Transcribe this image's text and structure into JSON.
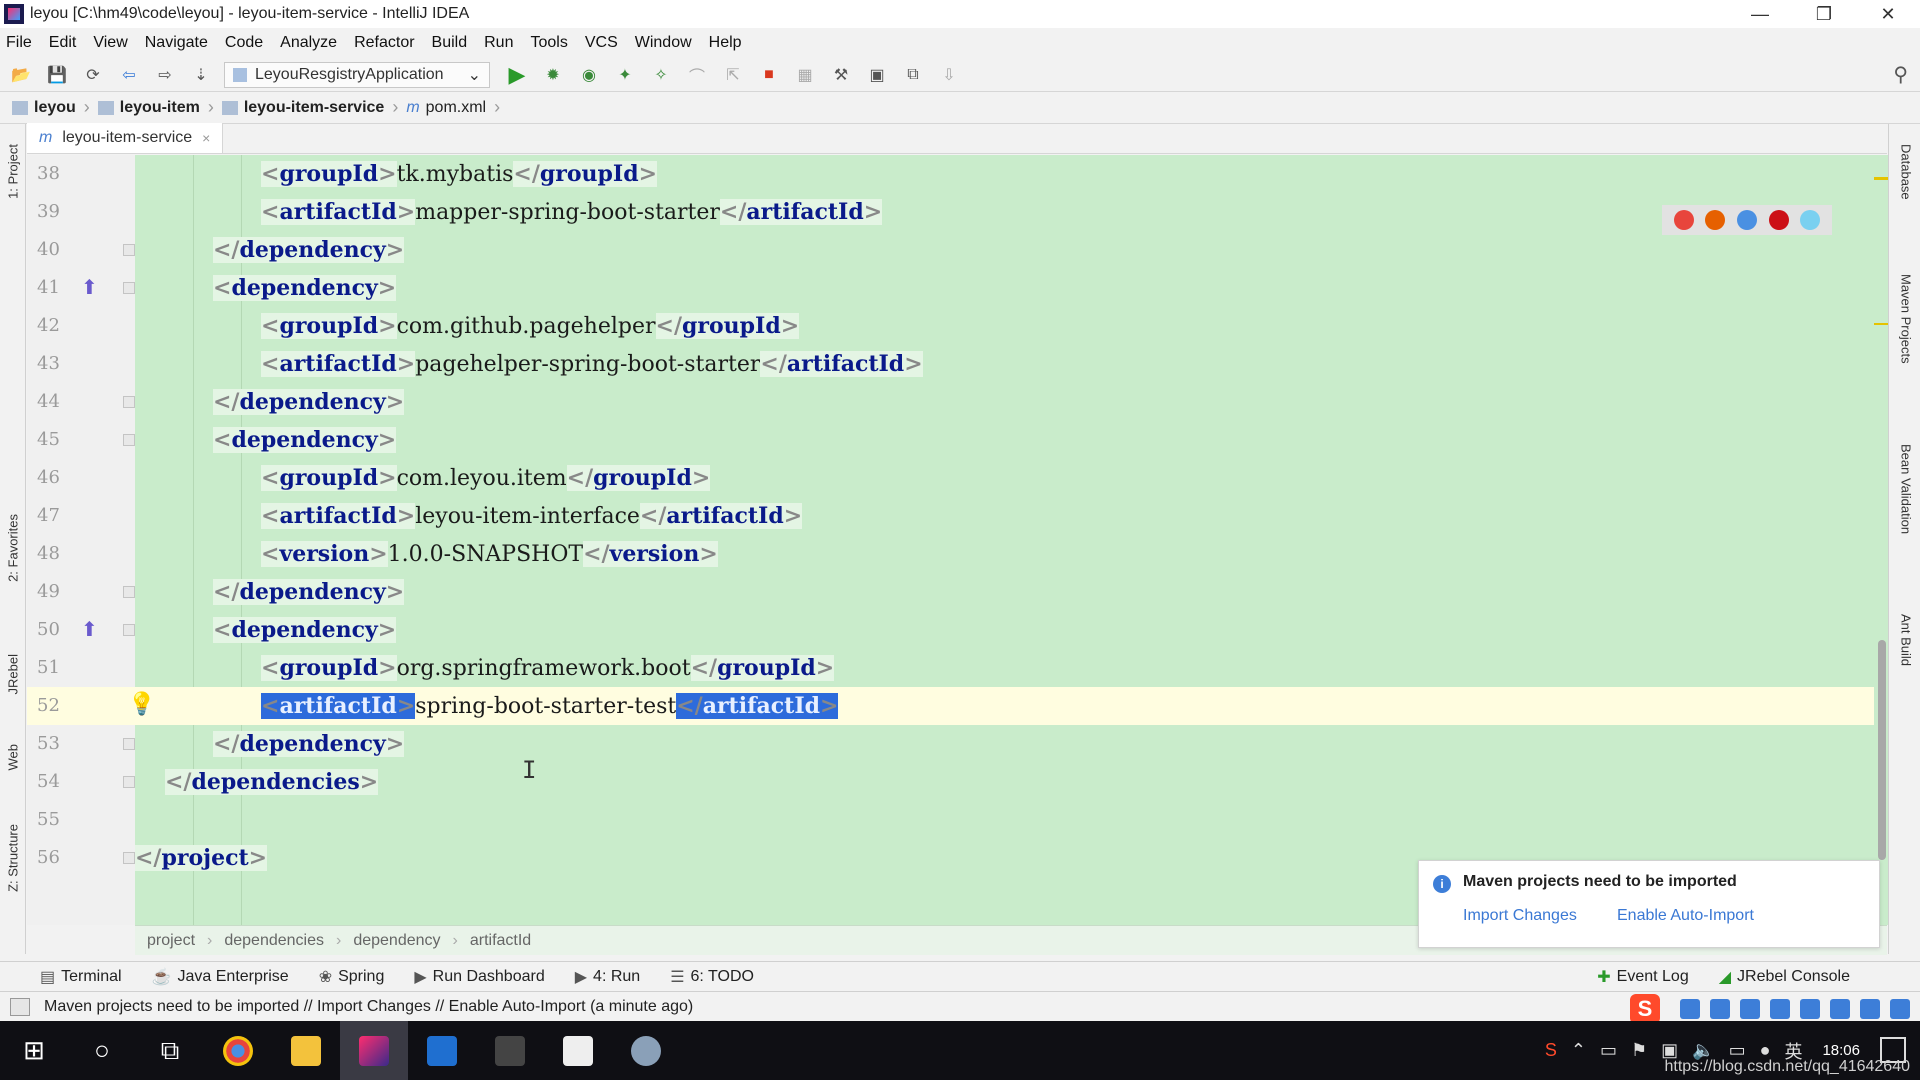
{
  "window": {
    "title": "leyou [C:\\hm49\\code\\leyou] - leyou-item-service - IntelliJ IDEA",
    "controls": [
      "—",
      "❐",
      "✕"
    ]
  },
  "menu": [
    "File",
    "Edit",
    "View",
    "Navigate",
    "Code",
    "Analyze",
    "Refactor",
    "Build",
    "Run",
    "Tools",
    "VCS",
    "Window",
    "Help"
  ],
  "toolbar": {
    "run_config": "LeyouResgistryApplication"
  },
  "breadcrumb": [
    "leyou",
    "leyou-item",
    "leyou-item-service",
    "pom.xml"
  ],
  "file_icon_letter": "m",
  "editor_tab": {
    "label": "leyou-item-service",
    "close": "×"
  },
  "left_tabs": [
    "1: Project",
    "2: Favorites",
    "JRebel",
    "Web",
    "Z: Structure"
  ],
  "right_tabs": [
    "Database",
    "Maven Projects",
    "Bean Validation",
    "Ant Build"
  ],
  "code_lines": [
    {
      "num": "38",
      "indent": 3,
      "open": "groupId",
      "text": "tk.mybatis",
      "close": "groupId"
    },
    {
      "num": "39",
      "indent": 3,
      "open": "artifactId",
      "text": "mapper-spring-boot-starter",
      "close": "artifactId"
    },
    {
      "num": "40",
      "indent": 2,
      "close_only": "dependency"
    },
    {
      "num": "41",
      "indent": 2,
      "open_only": "dependency"
    },
    {
      "num": "42",
      "indent": 3,
      "open": "groupId",
      "text": "com.github.pagehelper",
      "close": "groupId"
    },
    {
      "num": "43",
      "indent": 3,
      "open": "artifactId",
      "text": "pagehelper-spring-boot-starter",
      "close": "artifactId"
    },
    {
      "num": "44",
      "indent": 2,
      "close_only": "dependency"
    },
    {
      "num": "45",
      "indent": 2,
      "open_only": "dependency"
    },
    {
      "num": "46",
      "indent": 3,
      "open": "groupId",
      "text": "com.leyou.item",
      "close": "groupId"
    },
    {
      "num": "47",
      "indent": 3,
      "open": "artifactId",
      "text": "leyou-item-interface",
      "close": "artifactId"
    },
    {
      "num": "48",
      "indent": 3,
      "open": "version",
      "text": "1.0.0-SNAPSHOT",
      "close": "version"
    },
    {
      "num": "49",
      "indent": 2,
      "close_only": "dependency"
    },
    {
      "num": "50",
      "indent": 2,
      "open_only": "dependency"
    },
    {
      "num": "51",
      "indent": 3,
      "open": "groupId",
      "text": "org.springframework.boot",
      "close": "groupId"
    },
    {
      "num": "52",
      "indent": 3,
      "open": "artifactId",
      "text": "spring-boot-starter-test",
      "close": "artifactId",
      "current": true,
      "selected": true
    },
    {
      "num": "53",
      "indent": 2,
      "close_only": "dependency"
    },
    {
      "num": "54",
      "indent": 1,
      "close_only": "dependencies"
    },
    {
      "num": "55",
      "indent": 0,
      "empty": true
    },
    {
      "num": "56",
      "indent": 0,
      "close_only": "project"
    }
  ],
  "xml_path": [
    "project",
    "dependencies",
    "dependency",
    "artifactId"
  ],
  "notification": {
    "title": "Maven projects need to be imported",
    "import_changes": "Import Changes",
    "enable_auto_import": "Enable Auto-Import"
  },
  "bottom_tools": [
    {
      "icon": "▤",
      "label": "Terminal"
    },
    {
      "icon": "☕",
      "label": "Java Enterprise"
    },
    {
      "icon": "❀",
      "label": "Spring"
    },
    {
      "icon": "▶",
      "label": "Run Dashboard"
    },
    {
      "icon": "▶",
      "label": "4: Run"
    },
    {
      "icon": "☰",
      "label": "6: TODO"
    }
  ],
  "bottom_right_tools": [
    {
      "icon": "✚",
      "label": "Event Log"
    },
    {
      "icon": "◢",
      "label": "JRebel Console"
    }
  ],
  "status_message": "Maven projects need to be imported // Import Changes // Enable Auto-Import (a minute ago)",
  "taskbar": {
    "time": "18:06",
    "watermark": "https://blog.csdn.net/qq_41642640"
  },
  "colors": {
    "editor_bg": "#c9eccb",
    "tag_color": "#0a1a8a",
    "selection": "#2d6bdb",
    "link": "#3a78d4"
  }
}
